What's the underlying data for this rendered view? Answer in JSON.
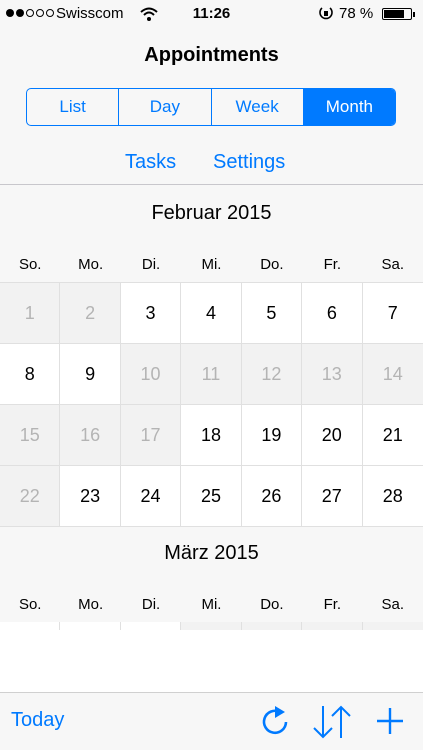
{
  "status_bar": {
    "carrier": "Swisscom",
    "time": "11:26",
    "battery": "78 %",
    "battery_level": 0.78,
    "signal_bars_filled": 2,
    "signal_bars_total": 5
  },
  "nav": {
    "title": "Appointments"
  },
  "segments": [
    {
      "label": "List",
      "active": false
    },
    {
      "label": "Day",
      "active": false
    },
    {
      "label": "Week",
      "active": false
    },
    {
      "label": "Month",
      "active": true
    }
  ],
  "links": {
    "tasks": "Tasks",
    "settings": "Settings"
  },
  "calendar": {
    "weekdays": [
      "So.",
      "Mo.",
      "Di.",
      "Mi.",
      "Do.",
      "Fr.",
      "Sa."
    ],
    "months": [
      {
        "title": "Februar 2015",
        "days": [
          {
            "d": "1",
            "out": true
          },
          {
            "d": "2",
            "out": true
          },
          {
            "d": "3",
            "out": false
          },
          {
            "d": "4",
            "out": false
          },
          {
            "d": "5",
            "out": false
          },
          {
            "d": "6",
            "out": false
          },
          {
            "d": "7",
            "out": false
          },
          {
            "d": "8",
            "out": false
          },
          {
            "d": "9",
            "out": false
          },
          {
            "d": "10",
            "out": true
          },
          {
            "d": "11",
            "out": true
          },
          {
            "d": "12",
            "out": true
          },
          {
            "d": "13",
            "out": true
          },
          {
            "d": "14",
            "out": true
          },
          {
            "d": "15",
            "out": true
          },
          {
            "d": "16",
            "out": true
          },
          {
            "d": "17",
            "out": true
          },
          {
            "d": "18",
            "out": false
          },
          {
            "d": "19",
            "out": false
          },
          {
            "d": "20",
            "out": false
          },
          {
            "d": "21",
            "out": false
          },
          {
            "d": "22",
            "out": true
          },
          {
            "d": "23",
            "out": false
          },
          {
            "d": "24",
            "out": false
          },
          {
            "d": "25",
            "out": false
          },
          {
            "d": "26",
            "out": false
          },
          {
            "d": "27",
            "out": false
          },
          {
            "d": "28",
            "out": false
          }
        ]
      },
      {
        "title": "März 2015"
      }
    ]
  },
  "toolbar": {
    "today": "Today",
    "icons": [
      "refresh-icon",
      "sort-icon",
      "add-icon"
    ]
  },
  "colors": {
    "accent": "#007aff",
    "muted_text": "#b4b4b4",
    "muted_bg": "#f2f2f2"
  }
}
